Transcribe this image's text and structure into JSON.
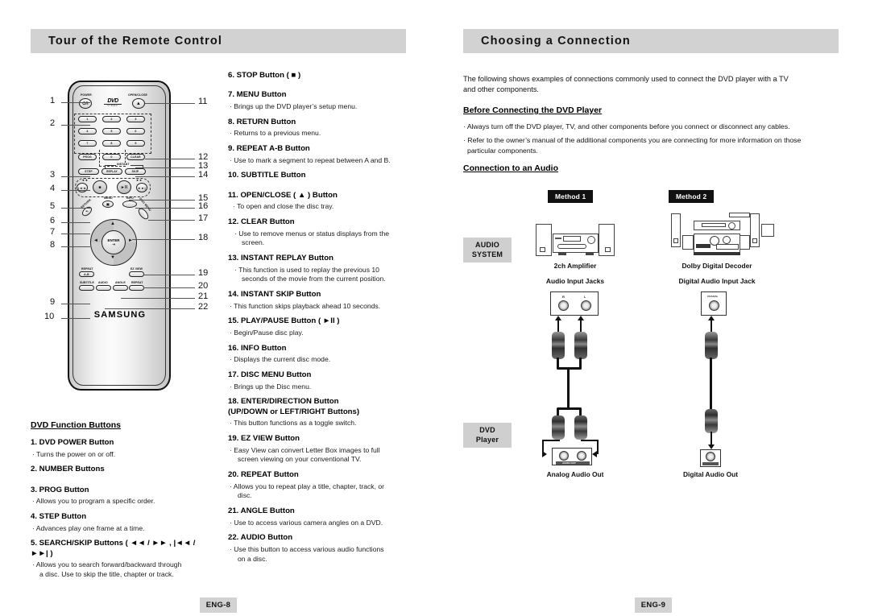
{
  "left_page": {
    "header": "Tour of the Remote Control",
    "footer": "ENG-8",
    "left_column": {
      "heading": "DVD Function Buttons",
      "entries": [
        {
          "title": "1. DVD POWER Button",
          "desc": [
            "· Turns the power on or off."
          ]
        },
        {
          "title": "2. NUMBER Buttons",
          "desc": []
        },
        {
          "title": "3. PROG Button",
          "desc": [
            "· Allows you to program a specific order."
          ]
        },
        {
          "title": "4. STEP Button",
          "desc": [
            "· Advances play one frame at a time."
          ]
        },
        {
          "title": "5. SEARCH/SKIP Buttons ( ◄◄ / ►► , |◄◄ / ►►| )",
          "desc": [
            "· Allows you to search forward/backward through",
            "a disc. Use to skip the title, chapter or track."
          ]
        }
      ]
    },
    "middle_column": {
      "entries": [
        {
          "title": "6. STOP Button ( ■ )",
          "desc": []
        },
        {
          "title": "7. MENU Button",
          "desc": [
            "· Brings up the DVD player’s setup menu."
          ]
        },
        {
          "title": "8. RETURN Button",
          "desc": [
            "· Returns to a previous menu."
          ]
        },
        {
          "title": "9. REPEAT A-B Button",
          "desc": [
            "· Use to mark a segment to repeat between A and B."
          ]
        },
        {
          "title": "10. SUBTITLE Button",
          "desc": []
        },
        {
          "title": "11. OPEN/CLOSE ( ▲ ) Button",
          "desc": [
            "· To open and close the disc tray."
          ]
        },
        {
          "title": "12. CLEAR Button",
          "desc": [
            "· Use to remove menus or status displays from the",
            "screen."
          ]
        },
        {
          "title": "13. INSTANT REPLAY Button",
          "desc": [
            "· This function is used to replay the previous 10",
            "seconds of the movie from the current position."
          ]
        },
        {
          "title": "14. INSTANT SKIP Button",
          "desc": [
            "· This function skips playback ahead 10 seconds."
          ]
        },
        {
          "title": "15. PLAY/PAUSE Button ( ►II )",
          "desc": [
            "· Begin/Pause disc play."
          ]
        },
        {
          "title": "16. INFO Button",
          "desc": [
            "· Displays the current disc mode."
          ]
        },
        {
          "title": "17. DISC MENU Button",
          "desc": [
            "· Brings up the Disc menu."
          ]
        },
        {
          "title": "18. ENTER/DIRECTION Button",
          "title2": "(UP/DOWN or LEFT/RIGHT Buttons)",
          "desc": [
            "· This button functions as a toggle switch."
          ]
        },
        {
          "title": "19. EZ VIEW Button",
          "desc": [
            "· Easy View can convert Letter Box images to full",
            "screen viewing on your conventional TV."
          ]
        },
        {
          "title": "20. REPEAT Button",
          "desc": [
            "· Allows you to repeat play a title, chapter, track, or",
            "disc."
          ]
        },
        {
          "title": "21. ANGLE Button",
          "desc": [
            "· Use to access various camera angles on a DVD."
          ]
        },
        {
          "title": "22. AUDIO Button",
          "desc": [
            "· Use this button to access various audio functions",
            "on a disc."
          ]
        }
      ]
    },
    "remote": {
      "brand": "SAMSUNG",
      "logo": "DVD",
      "logo_sub": "VIDEO",
      "labels": {
        "power": "POWER",
        "open_close": "OPEN/CLOSE",
        "prog": "PROG",
        "clear": "CLEAR",
        "instant": "INSTANT",
        "step": "STEP",
        "replay": "REPLAY",
        "skip": "SKIP",
        "menu": "MENU",
        "info": "INFO",
        "return": "RETURN",
        "disc_menu": "DISC MENU",
        "enter": "ENTER",
        "repeat_ab": "REPEAT",
        "repeat_ab2": "A-B",
        "ez_view": "EZ VIEW",
        "subtitle": "SUBTITLE",
        "audio": "AUDIO",
        "angle": "ANGLE",
        "repeat": "REPEAT"
      },
      "numbers": [
        "1",
        "2",
        "3",
        "4",
        "5",
        "6",
        "7",
        "8",
        "9",
        "0"
      ],
      "callouts_left": [
        "1",
        "2",
        "3",
        "4",
        "5",
        "6",
        "7",
        "8",
        "9",
        "10"
      ],
      "callouts_right": [
        "11",
        "12",
        "13",
        "14",
        "15",
        "16",
        "17",
        "18",
        "19",
        "20",
        "21",
        "22"
      ]
    }
  },
  "right_page": {
    "header": "Choosing a Connection",
    "footer": "ENG-9",
    "intro": [
      "The following shows examples of connections commonly used to connect the DVD player with a TV",
      "and other components."
    ],
    "before_heading": "Before Connecting the DVD Player",
    "before_bullets": [
      [
        "· Always turn off the DVD player, TV, and other components before you connect or disconnect any cables."
      ],
      [
        "· Refer to the owner’s manual of the additional components you are connecting for more information on those",
        "particular components."
      ]
    ],
    "connection_heading": "Connection to an Audio",
    "diagram": {
      "method1_tag": "Method 1",
      "method2_tag": "Method 2",
      "audio_system_tag_line1": "AUDIO",
      "audio_system_tag_line2": "SYSTEM",
      "dvd_player_tag_line1": "DVD",
      "dvd_player_tag_line2": "Player",
      "amp_caption": "2ch Amplifier",
      "amp_jacks_caption": "Audio Input Jacks",
      "decoder_caption": "Dolby Digital Decoder",
      "decoder_jack_caption": "Digital Audio Input Jack",
      "analog_out_caption": "Analog Audio Out",
      "digital_out_caption": "Digital Audio Out",
      "jack_r": "R",
      "jack_l": "L",
      "coaxial": "COAXIAL",
      "audio_out_strip": "AUDIO OUT"
    }
  }
}
